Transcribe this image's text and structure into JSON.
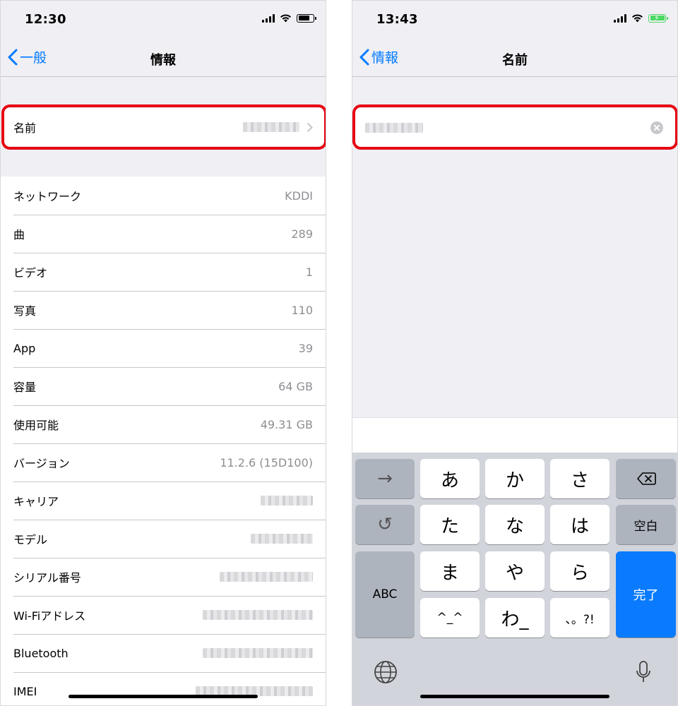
{
  "left": {
    "status": {
      "time": "12:30"
    },
    "nav": {
      "back_label": "一般",
      "title": "情報"
    },
    "name_row": {
      "label": "名前"
    },
    "rows": [
      {
        "label": "ネットワーク",
        "value": "KDDI"
      },
      {
        "label": "曲",
        "value": "289"
      },
      {
        "label": "ビデオ",
        "value": "1"
      },
      {
        "label": "写真",
        "value": "110"
      },
      {
        "label": "App",
        "value": "39"
      },
      {
        "label": "容量",
        "value": "64 GB"
      },
      {
        "label": "使用可能",
        "value": "49.31 GB"
      },
      {
        "label": "バージョン",
        "value": "11.2.6 (15D100)"
      },
      {
        "label": "キャリア",
        "value": ""
      },
      {
        "label": "モデル",
        "value": ""
      },
      {
        "label": "シリアル番号",
        "value": ""
      },
      {
        "label": "Wi-Fiアドレス",
        "value": ""
      },
      {
        "label": "Bluetooth",
        "value": ""
      },
      {
        "label": "IMEI",
        "value": ""
      }
    ]
  },
  "right": {
    "status": {
      "time": "13:43"
    },
    "nav": {
      "back_label": "情報",
      "title": "名前"
    },
    "keyboard": {
      "arrow": "→",
      "undo": "↺",
      "a": "あ",
      "ka": "か",
      "sa": "さ",
      "ta": "た",
      "na": "な",
      "ha": "は",
      "ma": "ま",
      "ya": "や",
      "ra": "ら",
      "caret": "^_^",
      "wa": "わ_",
      "punct": "、。?!",
      "abc": "ABC",
      "space": "空白",
      "done": "完了"
    }
  },
  "colors": {
    "accent": "#007aff",
    "highlight": "#e60012",
    "done_key": "#0a7bff",
    "battery_charging": "#4cd964"
  }
}
